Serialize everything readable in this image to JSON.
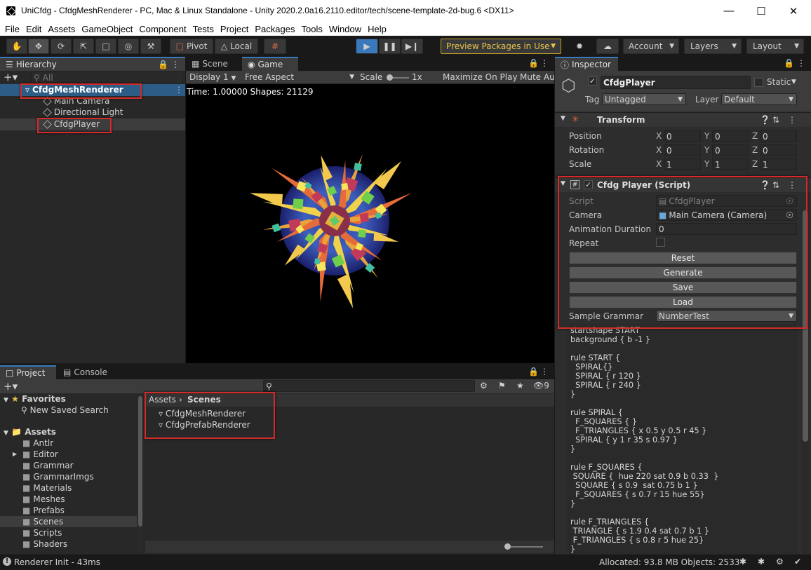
{
  "window": {
    "title": "UniCfdg - CfdgMeshRenderer - PC, Mac & Linux Standalone - Unity 2020.2.0a16.2110.editor/tech/scene-template-2d-bug.6 <DX11>"
  },
  "menu": [
    "File",
    "Edit",
    "Assets",
    "GameObject",
    "Component",
    "Tests",
    "Project",
    "Packages",
    "Tools",
    "Window",
    "Help"
  ],
  "toolbar": {
    "pivot": "Pivot",
    "local": "Local",
    "preview": "Preview Packages in Use",
    "account": "Account",
    "layers": "Layers",
    "layout": "Layout"
  },
  "hierarchy": {
    "tab": "Hierarchy",
    "search_placeholder": "All",
    "scene": "CfdgMeshRenderer",
    "items": [
      "Main Camera",
      "Directional Light",
      "CfdgPlayer"
    ]
  },
  "view": {
    "tabs": [
      "Scene",
      "Game"
    ],
    "display": "Display 1",
    "aspect": "Free Aspect",
    "scale_label": "Scale",
    "scale_value": "1x",
    "maximize": "Maximize On Play",
    "mute": "Mute Au",
    "overlay": "Time: 1.00000 Shapes: 21129"
  },
  "inspector": {
    "tab": "Inspector",
    "object_name": "CfdgPlayer",
    "static_label": "Static",
    "tag_label": "Tag",
    "tag": "Untagged",
    "layer_label": "Layer",
    "layer": "Default",
    "transform": {
      "title": "Transform",
      "rows": [
        {
          "label": "Position",
          "x": "0",
          "y": "0",
          "z": "0"
        },
        {
          "label": "Rotation",
          "x": "0",
          "y": "0",
          "z": "0"
        },
        {
          "label": "Scale",
          "x": "1",
          "y": "1",
          "z": "1"
        }
      ]
    },
    "script": {
      "title": "Cfdg Player (Script)",
      "script_label": "Script",
      "script_value": "CfdgPlayer",
      "camera_label": "Camera",
      "camera_value": "Main Camera (Camera)",
      "duration_label": "Animation Duration",
      "duration_value": "0",
      "repeat_label": "Repeat",
      "buttons": [
        "Reset",
        "Generate",
        "Save",
        "Load"
      ],
      "grammar_label": "Sample Grammar",
      "grammar_value": "NumberTest"
    },
    "code": "startshape START\nbackground { b -1 }\n\nrule START {\n  SPIRAL{}\n  SPIRAL { r 120 }\n  SPIRAL { r 240 }\n}\n\nrule SPIRAL {\n  F_SQUARES { }\n  F_TRIANGLES { x 0.5 y 0.5 r 45 }\n  SPIRAL { y 1 r 35 s 0.97 }\n}\n\nrule F_SQUARES {\n SQUARE {  hue 220 sat 0.9 b 0.33  }\n  SQUARE { s 0.9  sat 0.75 b 1 }\n  F_SQUARES { s 0.7 r 15 hue 55}\n}\n\nrule F_TRIANGLES {\n TRIANGLE { s 1.9 0.4 sat 0.7 b 1 }\n F_TRIANGLES { s 0.8 r 5 hue 25}\n}"
  },
  "project": {
    "tabs": [
      "Project",
      "Console"
    ],
    "hidden_count": "9",
    "favorites": "Favorites",
    "new_search": "New Saved Search",
    "assets": "Assets",
    "folders": [
      "Antlr",
      "Editor",
      "Grammar",
      "GrammarImgs",
      "Materials",
      "Meshes",
      "Prefabs",
      "Scenes",
      "Scripts",
      "Shaders"
    ],
    "breadcrumb": [
      "Assets",
      "Scenes"
    ],
    "files": [
      "CfdgMeshRenderer",
      "CfdgPrefabRenderer"
    ]
  },
  "status": {
    "message": "Renderer Init - 43ms",
    "memory": "Allocated: 93.8 MB Objects: 2533"
  }
}
